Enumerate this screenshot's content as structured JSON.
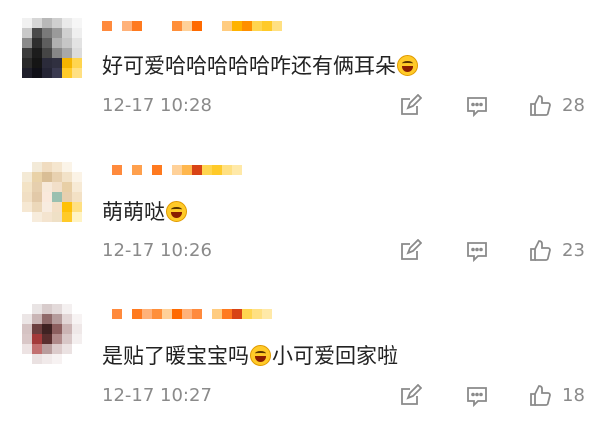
{
  "comments": [
    {
      "text_before": "好可爱哈哈哈哈哈咋还有俩耳朵",
      "emoji": "laughing-tears-emoji",
      "text_after": "",
      "time": "12-17 10:28",
      "likes": "28"
    },
    {
      "text_before": "萌萌哒",
      "emoji": "laughing-emoji",
      "text_after": "",
      "time": "12-17 10:26",
      "likes": "23"
    },
    {
      "text_before": "是贴了暖宝宝吗",
      "emoji": "laughing-emoji",
      "text_after": "小可爱回家啦",
      "time": "12-17 10:27",
      "likes": "18"
    }
  ],
  "icons": {
    "edit": "edit-icon",
    "reply": "comment-icon",
    "like": "thumbs-up-icon"
  },
  "colors": {
    "meta_text": "#8a8a8a",
    "body_text": "#222222",
    "username_blur": "#ff6a00"
  }
}
